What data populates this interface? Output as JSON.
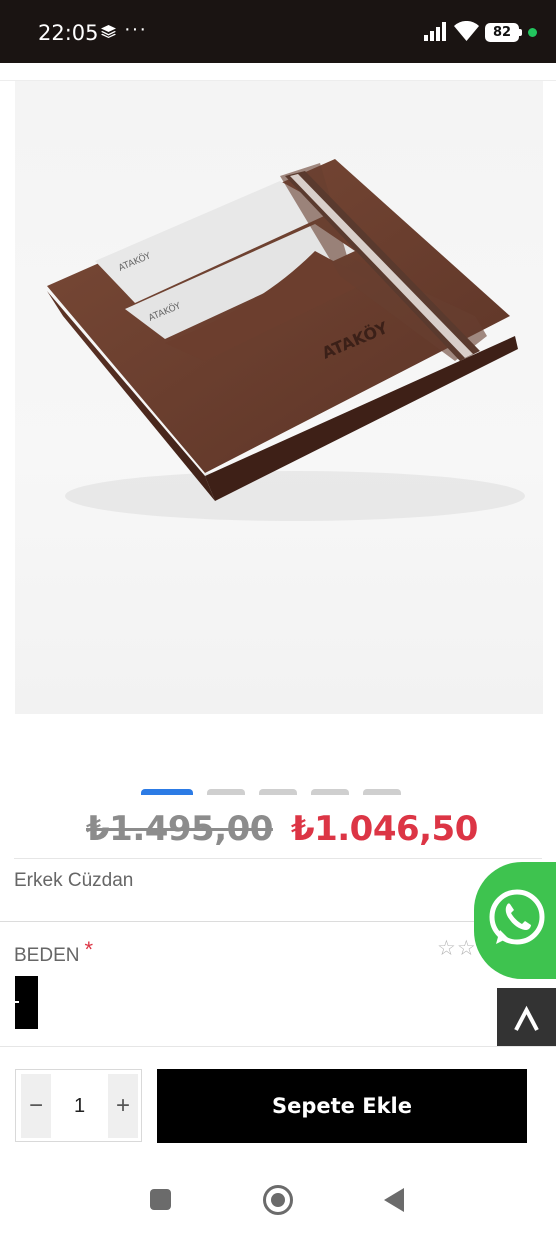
{
  "status_bar": {
    "time": "22:05",
    "more": "···",
    "battery": "82",
    "icons": [
      "layers-icon",
      "signal-icon",
      "wifi-icon",
      "battery-icon"
    ]
  },
  "product": {
    "image_alt": "wallet-product-image",
    "brand_on_image": "ATAKÖY",
    "carousel": {
      "total": 5,
      "active_index": 0
    },
    "old_price": "₺1.495,00",
    "new_price": "₺1.046,50",
    "category": "Erkek Cüzdan",
    "size_label": "BEDEN",
    "required_mark": "*",
    "rating_stars": "☆☆"
  },
  "cart": {
    "minus": "−",
    "quantity": "1",
    "plus": "+",
    "add_label": "Sepete Ekle"
  },
  "floating": {
    "whatsapp_icon": "whatsapp-icon",
    "back_to_top": "^"
  },
  "colors": {
    "accent_blue": "#2c7be5",
    "price_red": "#dc3545",
    "whatsapp_green": "#3ec34f",
    "button_black": "#000000"
  }
}
